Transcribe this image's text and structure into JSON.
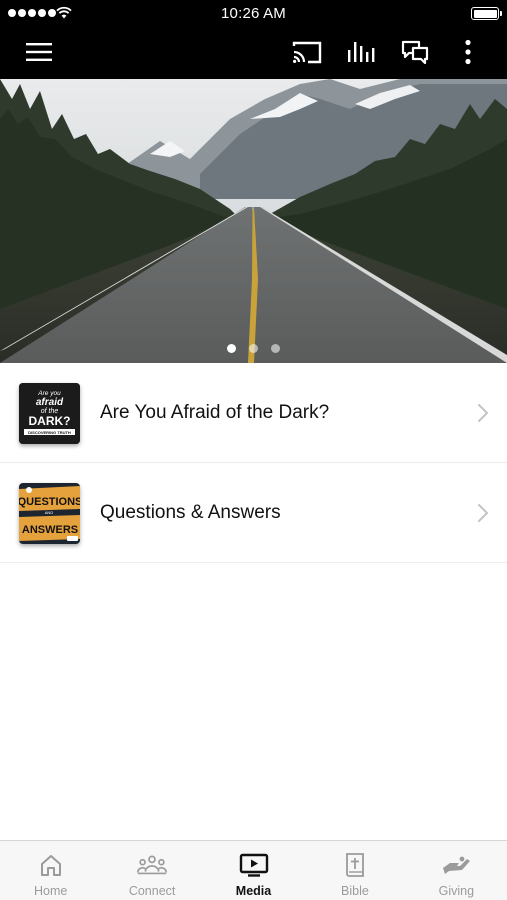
{
  "status_bar": {
    "time": "10:26 AM",
    "signal_icon": "signal-dots-icon",
    "wifi_icon": "wifi-icon",
    "battery_icon": "battery-icon",
    "battery_level": 1.0
  },
  "app_bar": {
    "menu_icon": "hamburger-menu-icon",
    "cast_icon": "cast-icon",
    "audio_icon": "equalizer-bars-icon",
    "chat_icon": "chat-bubbles-icon",
    "more_icon": "more-vertical-icon"
  },
  "hero": {
    "image": "mountain-road-photo",
    "slide_count": 3,
    "active_slide": 1
  },
  "media_list": [
    {
      "title": "Are You Afraid of the Dark?",
      "thumb_text": [
        "Are you",
        "afraid",
        "of the",
        "DARK?",
        "DISCOVERING TRUTH"
      ]
    },
    {
      "title": "Questions & Answers",
      "thumb_text": [
        "QUESTIONS",
        "AND",
        "ANSWERS"
      ]
    }
  ],
  "tab_bar": {
    "tabs": [
      {
        "label": "Home",
        "icon": "home-icon",
        "active": false
      },
      {
        "label": "Connect",
        "icon": "people-icon",
        "active": false
      },
      {
        "label": "Media",
        "icon": "tv-play-icon",
        "active": true
      },
      {
        "label": "Bible",
        "icon": "bible-icon",
        "active": false
      },
      {
        "label": "Giving",
        "icon": "giving-hand-icon",
        "active": false
      }
    ]
  },
  "colors": {
    "bar_background": "#000000",
    "tab_active": "#111111",
    "tab_inactive": "#9b9b9b",
    "thumb_accent": "#e5a13b"
  }
}
